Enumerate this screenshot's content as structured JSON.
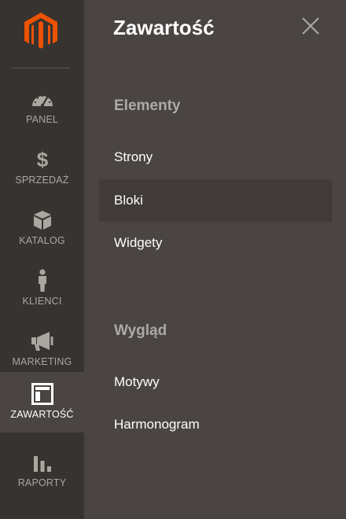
{
  "colors": {
    "sidebar_bg": "#373330",
    "panel_bg": "#4a4542",
    "brand_orange": "#eb5202",
    "inactive_text": "#aaa6a0",
    "section_title": "#adaaa7"
  },
  "sidebar": {
    "logo_icon": "magento-logo",
    "items": [
      {
        "label": "PANEL",
        "icon": "dashboard-gauge-icon",
        "active": false
      },
      {
        "label": "SPRZEDAŻ",
        "icon": "dollar-icon",
        "active": false
      },
      {
        "label": "KATALOG",
        "icon": "box-icon",
        "active": false
      },
      {
        "label": "KLIENCI",
        "icon": "person-icon",
        "active": false
      },
      {
        "label": "MARKETING",
        "icon": "megaphone-icon",
        "active": false
      },
      {
        "label": "ZAWARTOŚĆ",
        "icon": "layout-icon",
        "active": true
      },
      {
        "label": "RAPORTY",
        "icon": "bar-chart-icon",
        "active": false
      }
    ]
  },
  "panel": {
    "title": "Zawartość",
    "close_icon": "close-icon",
    "sections": [
      {
        "title": "Elementy",
        "items": [
          "Strony",
          "Bloki",
          "Widgety"
        ]
      },
      {
        "title": "Wygląd",
        "items": [
          "Motywy",
          "Harmonogram"
        ]
      }
    ],
    "highlighted_item": "Bloki"
  }
}
